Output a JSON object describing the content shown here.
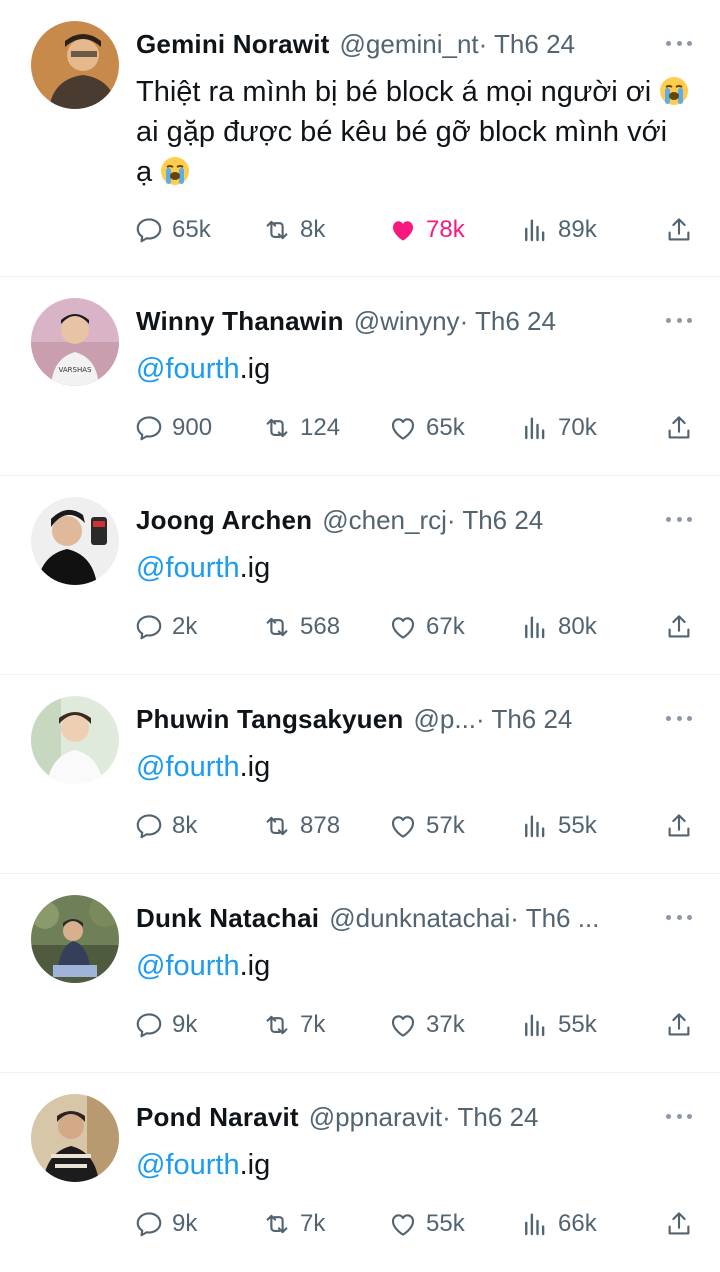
{
  "tweets": [
    {
      "name": "Gemini Norawit",
      "handle": "@gemini_nt",
      "meta": " · Th6 24",
      "text_parts": [
        "Thiệt ra mình bị bé block á mọi người ơi ",
        " ai gặp được bé kêu bé gỡ block mình với ạ "
      ],
      "emoji": "loudly-crying-face",
      "counts": {
        "replies": "65k",
        "retweets": "8k",
        "likes": "78k",
        "views": "89k"
      },
      "liked": true
    },
    {
      "name": "Winny Thanawin",
      "handle": "@winyny",
      "meta": " · Th6 24",
      "mention": "@fourth",
      "suffix": ".ig",
      "counts": {
        "replies": "900",
        "retweets": "124",
        "likes": "65k",
        "views": "70k"
      },
      "liked": false
    },
    {
      "name": "Joong Archen",
      "handle": "@chen_rcj",
      "meta": " · Th6 24",
      "mention": "@fourth",
      "suffix": ".ig",
      "counts": {
        "replies": "2k",
        "retweets": "568",
        "likes": "67k",
        "views": "80k"
      },
      "liked": false
    },
    {
      "name": "Phuwin Tangsakyuen",
      "handle": "@p...",
      "meta": " · Th6 24",
      "mention": "@fourth",
      "suffix": ".ig",
      "counts": {
        "replies": "8k",
        "retweets": "878",
        "likes": "57k",
        "views": "55k"
      },
      "liked": false
    },
    {
      "name": "Dunk Natachai",
      "handle": "@dunknatachai",
      "meta": " · Th6 ...",
      "mention": "@fourth",
      "suffix": ".ig",
      "counts": {
        "replies": "9k",
        "retweets": "7k",
        "likes": "37k",
        "views": "55k"
      },
      "liked": false
    },
    {
      "name": "Pond Naravit",
      "handle": "@ppnaravit",
      "meta": " · Th6 24",
      "mention": "@fourth",
      "suffix": ".ig",
      "counts": {
        "replies": "9k",
        "retweets": "7k",
        "likes": "55k",
        "views": "66k"
      },
      "liked": false
    }
  ],
  "colors": {
    "accent": "#1d9bf0",
    "like": "#f91880",
    "secondary_text": "#536471",
    "divider": "#eff3f4"
  }
}
